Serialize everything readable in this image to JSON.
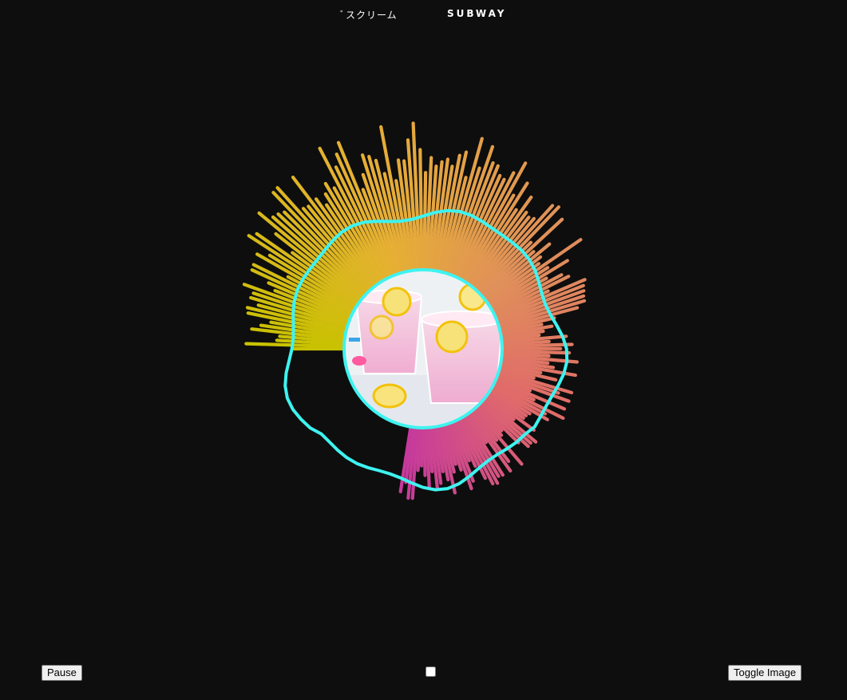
{
  "header": {
    "title_left": "ﾞスクリーム",
    "title_right": "SUBWAY"
  },
  "controls": {
    "pause_label": "Pause",
    "toggle_image_label": "Toggle Image",
    "checkbox_checked": false
  },
  "visualizer": {
    "center_image_icon": "pink-lemonade-glasses-photo",
    "ring_color": "#3ef3f0",
    "gradient_colors": [
      "#c8c200",
      "#e6b033",
      "#e0905a",
      "#e06a6a",
      "#c63a9c"
    ],
    "background_color": "#0e0e0e"
  }
}
